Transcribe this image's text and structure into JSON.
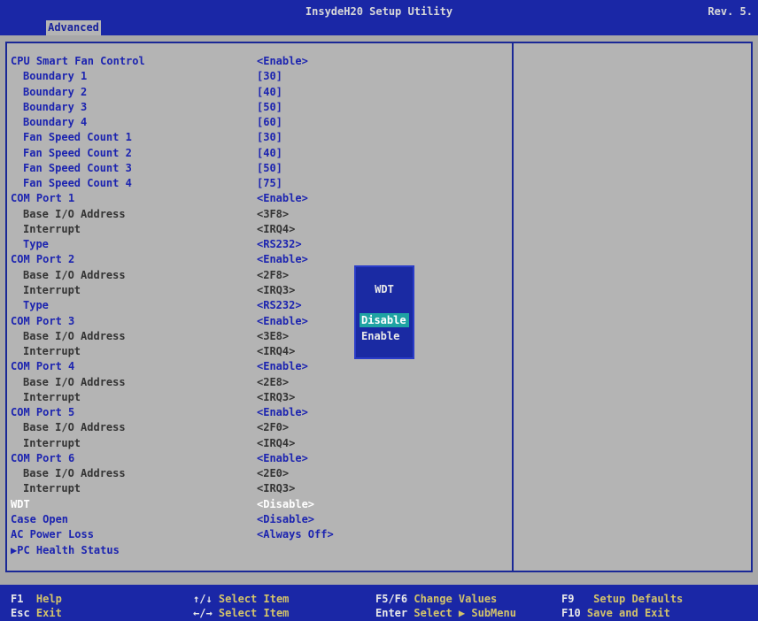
{
  "header": {
    "title": "InsydeH20 Setup Utility",
    "revision": "Rev. 5.",
    "active_tab": "Advanced"
  },
  "menu": {
    "items": [
      {
        "label": "CPU Smart Fan Control",
        "value": "<Enable>",
        "indent": false,
        "state": "active"
      },
      {
        "label": "Boundary 1",
        "value": "[30]",
        "indent": true,
        "state": "active"
      },
      {
        "label": "Boundary 2",
        "value": "[40]",
        "indent": true,
        "state": "active"
      },
      {
        "label": "Boundary 3",
        "value": "[50]",
        "indent": true,
        "state": "active"
      },
      {
        "label": "Boundary 4",
        "value": "[60]",
        "indent": true,
        "state": "active"
      },
      {
        "label": "Fan Speed Count 1",
        "value": "[30]",
        "indent": true,
        "state": "active"
      },
      {
        "label": "Fan Speed Count 2",
        "value": "[40]",
        "indent": true,
        "state": "active"
      },
      {
        "label": "Fan Speed Count 3",
        "value": "[50]",
        "indent": true,
        "state": "active"
      },
      {
        "label": "Fan Speed Count 4",
        "value": "[75]",
        "indent": true,
        "state": "active"
      },
      {
        "label": "COM Port 1",
        "value": "<Enable>",
        "indent": false,
        "state": "active"
      },
      {
        "label": "Base I/O Address",
        "value": "<3F8>",
        "indent": true,
        "state": "inactive"
      },
      {
        "label": "Interrupt",
        "value": "<IRQ4>",
        "indent": true,
        "state": "inactive"
      },
      {
        "label": "Type",
        "value": "<RS232>",
        "indent": true,
        "state": "active"
      },
      {
        "label": "COM Port 2",
        "value": "<Enable>",
        "indent": false,
        "state": "active"
      },
      {
        "label": "Base I/O Address",
        "value": "<2F8>",
        "indent": true,
        "state": "inactive"
      },
      {
        "label": "Interrupt",
        "value": "<IRQ3>",
        "indent": true,
        "state": "inactive"
      },
      {
        "label": "Type",
        "value": "<RS232>",
        "indent": true,
        "state": "active"
      },
      {
        "label": "COM Port 3",
        "value": "<Enable>",
        "indent": false,
        "state": "active"
      },
      {
        "label": "Base I/O Address",
        "value": "<3E8>",
        "indent": true,
        "state": "inactive"
      },
      {
        "label": "Interrupt",
        "value": "<IRQ4>",
        "indent": true,
        "state": "inactive"
      },
      {
        "label": "COM Port 4",
        "value": "<Enable>",
        "indent": false,
        "state": "active"
      },
      {
        "label": "Base I/O Address",
        "value": "<2E8>",
        "indent": true,
        "state": "inactive"
      },
      {
        "label": "Interrupt",
        "value": "<IRQ3>",
        "indent": true,
        "state": "inactive"
      },
      {
        "label": "COM Port 5",
        "value": "<Enable>",
        "indent": false,
        "state": "active"
      },
      {
        "label": "Base I/O Address",
        "value": "<2F0>",
        "indent": true,
        "state": "inactive"
      },
      {
        "label": "Interrupt",
        "value": "<IRQ4>",
        "indent": true,
        "state": "inactive"
      },
      {
        "label": "COM Port 6",
        "value": "<Enable>",
        "indent": false,
        "state": "active"
      },
      {
        "label": "Base I/O Address",
        "value": "<2E0>",
        "indent": true,
        "state": "inactive"
      },
      {
        "label": "Interrupt",
        "value": "<IRQ3>",
        "indent": true,
        "state": "inactive"
      },
      {
        "label": "WDT",
        "value": "<Disable>",
        "indent": false,
        "state": "highlighted"
      },
      {
        "label": "Case Open",
        "value": "<Disable>",
        "indent": false,
        "state": "active"
      },
      {
        "label": "AC Power Loss",
        "value": "<Always Off>",
        "indent": false,
        "state": "active"
      },
      {
        "label": "▶PC Health Status",
        "value": "",
        "indent": false,
        "state": "active"
      }
    ]
  },
  "popup": {
    "title": "WDT",
    "options": [
      "Disable",
      "Enable"
    ],
    "selected": "Disable"
  },
  "footer": {
    "hints": [
      {
        "key": "F1",
        "desc": "Help"
      },
      {
        "key": "Esc",
        "desc": "Exit"
      },
      {
        "key": "↑/↓",
        "desc": "Select Item"
      },
      {
        "key": "←/→",
        "desc": "Select Item"
      },
      {
        "key": "F5/F6",
        "desc": "Change Values"
      },
      {
        "key": "Enter",
        "desc": "Select ▶ SubMenu"
      },
      {
        "key": "F9",
        "desc": "Setup Defaults"
      },
      {
        "key": "F10",
        "desc": "Save and Exit"
      }
    ]
  },
  "colors": {
    "background": "#a8a8a8",
    "bar": "#1a27a6",
    "active_text": "#1c24b0",
    "inactive_text": "#343434",
    "highlight_text": "#ffffff",
    "popup_selection": "#1fa3a3",
    "footer_desc": "#d4c46a"
  }
}
